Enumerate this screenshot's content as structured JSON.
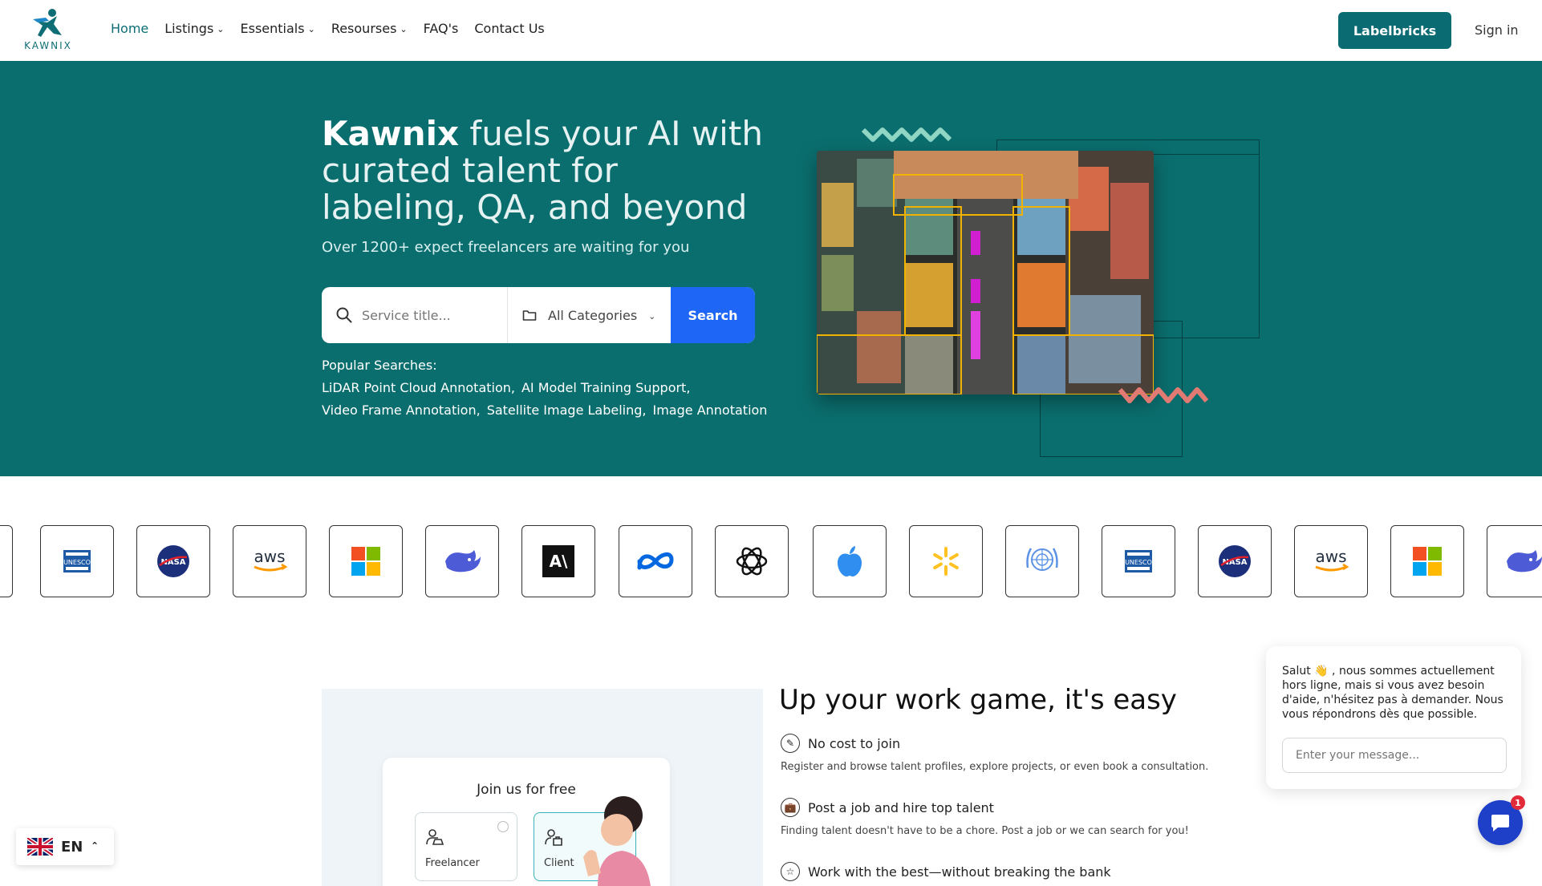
{
  "nav": {
    "logo_text": "KAWNIX",
    "items": [
      {
        "label": "Home",
        "dropdown": false,
        "active": true
      },
      {
        "label": "Listings",
        "dropdown": true,
        "active": false
      },
      {
        "label": "Essentials",
        "dropdown": true,
        "active": false
      },
      {
        "label": "Resourses",
        "dropdown": true,
        "active": false
      },
      {
        "label": "FAQ's",
        "dropdown": false,
        "active": false
      },
      {
        "label": "Contact Us",
        "dropdown": false,
        "active": false
      }
    ],
    "cta_label": "Labelbricks",
    "signin_label": "Sign in"
  },
  "hero": {
    "title_brand": "Kawnix",
    "title_rest": " fuels your AI with curated talent for labeling, QA, and beyond",
    "subtitle": "Over 1200+ expect freelancers are waiting for you",
    "search": {
      "placeholder": "Service title...",
      "category": "All Categories",
      "button_label": "Search"
    },
    "popular_label": "Popular Searches:",
    "popular": [
      "LiDAR Point Cloud Annotation,",
      "AI Model Training Support,",
      "Video Frame Annotation,",
      "Satellite Image Labeling,",
      "Image Annotation"
    ]
  },
  "partners": [
    "anthropic-icon",
    "unesco-icon",
    "nasa-icon",
    "aws-icon",
    "microsoft-icon",
    "deepseek-icon",
    "anthropic-icon",
    "meta-icon",
    "openai-icon",
    "apple-icon",
    "walmart-icon",
    "un-icon",
    "unesco-icon",
    "nasa-icon",
    "aws-icon",
    "microsoft-icon",
    "deepseek-icon"
  ],
  "partner_texts": {
    "unesco": "UNESCO",
    "nasa": "NASA",
    "aws": "aws",
    "anthropic": "A\\"
  },
  "work": {
    "join_title": "Join us for free",
    "roles": [
      "Freelancer",
      "Client"
    ],
    "title": "Up your work game, it's easy",
    "features": [
      {
        "title": "No cost to join",
        "desc": "Register and browse talent profiles, explore projects, or even book a consultation.",
        "icon": "pencil-icon"
      },
      {
        "title": "Post a job and hire top talent",
        "desc": "Finding talent doesn't have to be a chore. Post a job or we can search for you!",
        "icon": "briefcase-icon"
      },
      {
        "title": "Work with the best—without breaking the bank",
        "desc": "",
        "icon": "star-icon"
      }
    ]
  },
  "chat": {
    "message": "Salut 👋 , nous sommes actuellement hors ligne, mais si vous avez besoin d'aide, n'hésitez pas à demander. Nous vous répondrons dès que possible.",
    "placeholder": "Enter your message...",
    "badge": "1"
  },
  "language": {
    "code": "EN"
  },
  "colors": {
    "primary": "#0b6e6e",
    "search_button": "#1e66f5",
    "chat_button": "#1e40c8"
  }
}
